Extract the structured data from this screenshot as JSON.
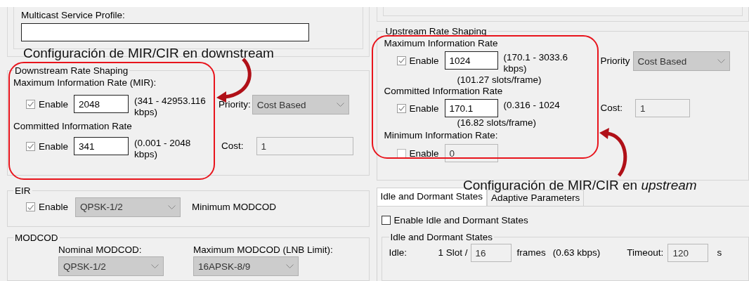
{
  "multicast": {
    "label": "Multicast Service Profile:"
  },
  "downstream": {
    "title": "Downstream Rate Shaping",
    "mir": {
      "label": "Maximum Information Rate (MIR):",
      "enable": {
        "label": "Enable",
        "checked": true
      },
      "field": {
        "value": "2048",
        "disabled": false
      },
      "range": "(341 - 42953.116 kbps)"
    },
    "cir": {
      "label": "Committed Information Rate",
      "enable": {
        "label": "Enable",
        "checked": true
      },
      "field": {
        "value": "341",
        "disabled": false
      },
      "range": "(0.001 - 2048 kbps)"
    },
    "priority": {
      "label": "Priority:",
      "value": "Cost Based"
    },
    "cost": {
      "label": "Cost:",
      "field": {
        "value": "1",
        "disabled": true
      }
    }
  },
  "eir": {
    "title": "EIR",
    "enable": {
      "label": "Enable",
      "checked": true
    },
    "combo": "QPSK-1/2",
    "label": "Minimum MODCOD"
  },
  "modcod": {
    "title": "MODCOD",
    "nominal": {
      "label": "Nominal MODCOD:",
      "value": "QPSK-1/2"
    },
    "maximum": {
      "label": "Maximum MODCOD (LNB Limit):",
      "value": "16APSK-8/9"
    }
  },
  "upstream": {
    "title": "Upstream Rate Shaping",
    "mir": {
      "label": "Maximum Information Rate",
      "enable": {
        "label": "Enable",
        "checked": true
      },
      "field": {
        "value": "1024",
        "disabled": false
      },
      "range": "(170.1 - 3033.6 kbps)",
      "slots": "(101.27 slots/frame)"
    },
    "cir": {
      "label": "Committed Information Rate",
      "enable": {
        "label": "Enable",
        "checked": true
      },
      "field": {
        "value": "170.1",
        "disabled": false
      },
      "range": "(0.316 - 1024",
      "slots": "(16.82 slots/frame)"
    },
    "min": {
      "label": "Minimum Information Rate:",
      "enable": {
        "label": "Enable",
        "checked": false
      },
      "field": {
        "value": "0",
        "disabled": true
      }
    },
    "priority": {
      "label": "Priority",
      "value": "Cost Based"
    },
    "cost": {
      "label": "Cost:",
      "field": {
        "value": "1",
        "disabled": true
      }
    }
  },
  "tabs": [
    {
      "label": "Idle and Dormant States",
      "selected": true
    },
    {
      "label": "Adaptive Parameters",
      "selected": false
    }
  ],
  "idle": {
    "enable": {
      "label": "Enable Idle and Dormant States",
      "checked": false
    },
    "title": "Idle and Dormant States",
    "label": "Idle:",
    "slot": "1 Slot /",
    "field": {
      "value": "16",
      "disabled": true
    },
    "frames": "frames",
    "rate": "(0.63 kbps)",
    "timeout": {
      "label": "Timeout:",
      "field": {
        "value": "120",
        "disabled": true
      }
    },
    "unit": "s"
  },
  "annotations": [
    {
      "text": "Configuración de MIR/CIR en downstream"
    },
    {
      "text": "Configuración de MIR/CIR en *upstream*"
    }
  ]
}
